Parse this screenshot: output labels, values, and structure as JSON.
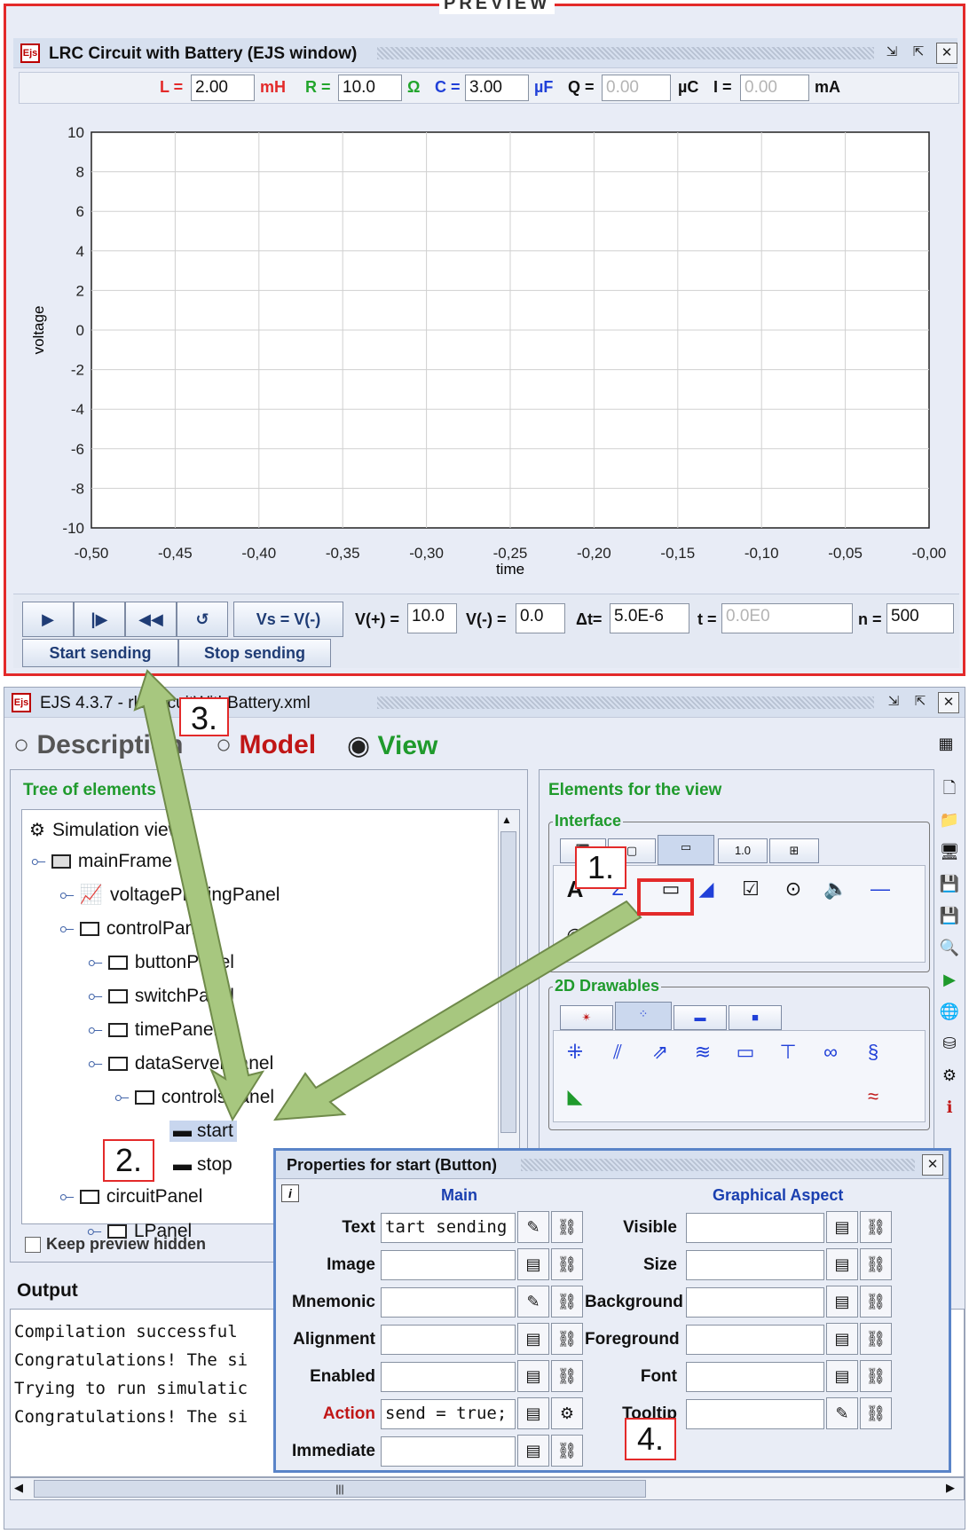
{
  "preview": {
    "label": "PREVIEW",
    "window_title": "LRC Circuit with Battery (EJS window)",
    "params": {
      "L_label": "L =",
      "L_value": "2.00",
      "L_unit": "mH",
      "R_label": "R =",
      "R_value": "10.0",
      "R_unit": "Ω",
      "C_label": "C =",
      "C_value": "3.00",
      "C_unit": "µF",
      "Q_label": "Q =",
      "Q_value": "0.00",
      "Q_unit": "µC",
      "I_label": "I =",
      "I_value": "0.00",
      "I_unit": "mA"
    },
    "controls": {
      "vs_button": "Vs = V(-)",
      "vplus_label": "V(+) =",
      "vplus_value": "10.0",
      "vminus_label": "V(-) =",
      "vminus_value": "0.0",
      "dt_label": "Δt=",
      "dt_value": "5.0E-6",
      "t_label": "t =",
      "t_value": "0.0E0",
      "n_label": "n =",
      "n_value": "500",
      "start_sending": "Start sending",
      "stop_sending": "Stop sending"
    },
    "colors": {
      "L": "#e32a2a",
      "R": "#22a52c",
      "C": "#2040d8"
    }
  },
  "chart_data": {
    "type": "line",
    "title": "",
    "xlabel": "time",
    "ylabel": "voltage",
    "xlim": [
      -0.5,
      0.0
    ],
    "ylim": [
      -10,
      10
    ],
    "x_ticks": [
      "-0,50",
      "-0,45",
      "-0,40",
      "-0,35",
      "-0,30",
      "-0,25",
      "-0,20",
      "-0,15",
      "-0,10",
      "-0,05",
      "-0,00"
    ],
    "y_ticks": [
      "10",
      "8",
      "6",
      "4",
      "2",
      "0",
      "-2",
      "-4",
      "-6",
      "-8",
      "-10"
    ],
    "grid": true,
    "series": []
  },
  "ejs": {
    "window_title": "EJS 4.3.7 - rlcCircuitWithBattery.xml",
    "radio_description": "Description",
    "radio_model": "Model",
    "radio_view": "View",
    "tree_title": "Tree of elements",
    "tree": [
      {
        "label": "Simulation view"
      },
      {
        "label": "mainFrame"
      },
      {
        "label": "voltagePlottingPanel"
      },
      {
        "label": "controlPanel"
      },
      {
        "label": "buttonPanel"
      },
      {
        "label": "switchPanel"
      },
      {
        "label": "timePanel"
      },
      {
        "label": "dataServerPanel"
      },
      {
        "label": "controlsPanel"
      },
      {
        "label": "start"
      },
      {
        "label": "stop"
      },
      {
        "label": "circuitPanel"
      },
      {
        "label": "LPanel"
      }
    ],
    "keep_preview_hidden": "Keep preview hidden",
    "elements_title": "Elements for the view",
    "interface_group": "Interface",
    "drawables_group": "2D Drawables",
    "interface_tab_text": "1.0",
    "output_title": "Output",
    "output_lines": [
      "Compilation successful",
      "Congratulations! The si",
      "Trying to run simulatic",
      "Congratulations! The si"
    ],
    "scroll_grip": "|||"
  },
  "props": {
    "title": "Properties for start (Button)",
    "main_header": "Main",
    "graphical_header": "Graphical Aspect",
    "main": [
      {
        "name": "Text",
        "value": "tart sending"
      },
      {
        "name": "Image",
        "value": ""
      },
      {
        "name": "Mnemonic",
        "value": ""
      },
      {
        "name": "Alignment",
        "value": ""
      },
      {
        "name": "Enabled",
        "value": ""
      },
      {
        "name": "Action",
        "value": "send = true;"
      },
      {
        "name": "Immediate",
        "value": ""
      }
    ],
    "graphical": [
      {
        "name": "Visible",
        "value": ""
      },
      {
        "name": "Size",
        "value": ""
      },
      {
        "name": "Background",
        "value": ""
      },
      {
        "name": "Foreground",
        "value": ""
      },
      {
        "name": "Font",
        "value": ""
      },
      {
        "name": "Tooltip",
        "value": ""
      }
    ]
  },
  "callouts": {
    "c1": "1.",
    "c2": "2.",
    "c3": "3.",
    "c4": "4."
  }
}
